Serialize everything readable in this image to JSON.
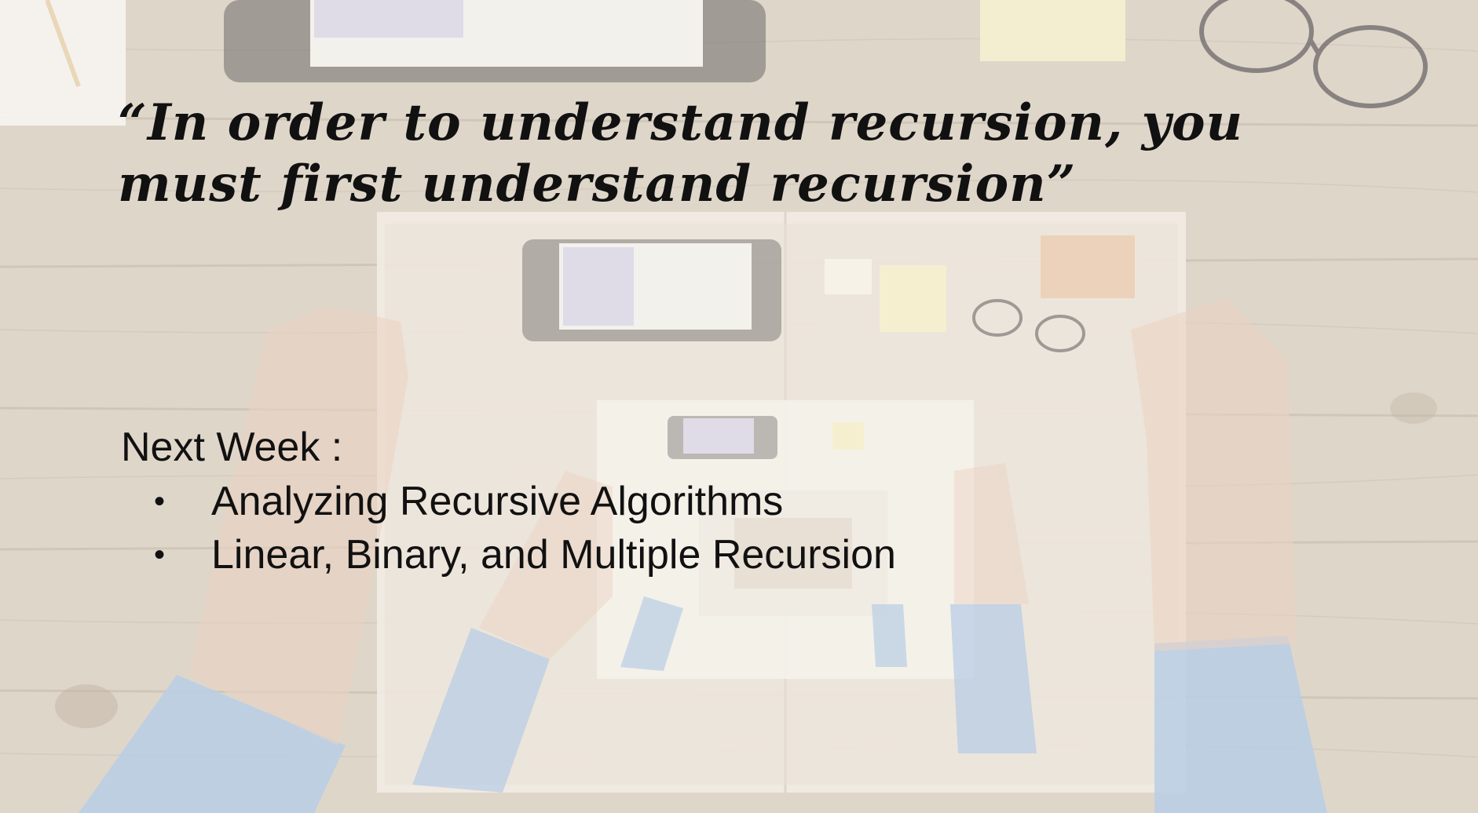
{
  "slide": {
    "quote": "“In order to understand recursion, you must first understand recursion”",
    "next_week_heading": "Next Week :",
    "topics": [
      "Analyzing Recursive Algorithms",
      "Linear, Binary, and Multiple Recursion"
    ],
    "bullet_glyph": "•"
  },
  "colors": {
    "text": "#111111",
    "wood": "#d9cfc1",
    "sleeve": "#a9c3e0",
    "paper": "#f3efe6"
  }
}
